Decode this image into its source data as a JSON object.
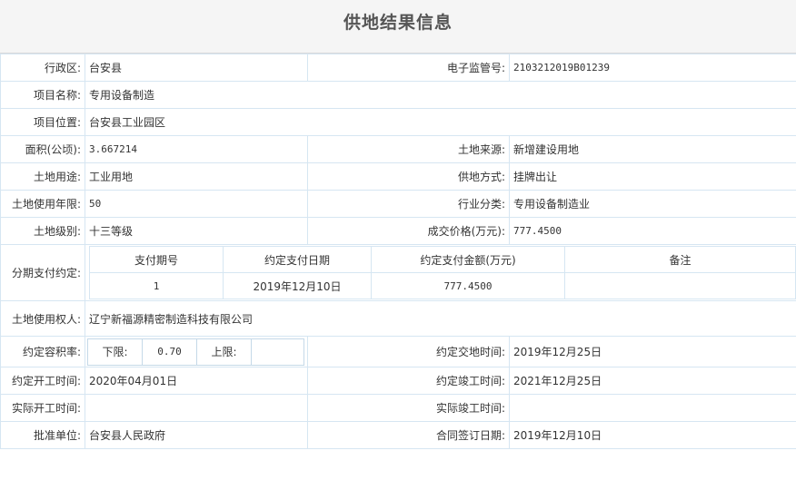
{
  "page": {
    "title": "供地结果信息"
  },
  "rows": {
    "district": {
      "label": "行政区:",
      "value": "台安县"
    },
    "supervision_no": {
      "label": "电子监管号:",
      "value": "2103212019B01239"
    },
    "project_name": {
      "label": "项目名称:",
      "value": "专用设备制造"
    },
    "project_location": {
      "label": "项目位置:",
      "value": "台安县工业园区"
    },
    "area": {
      "label": "面积(公顷):",
      "value": "3.667214"
    },
    "land_source": {
      "label": "土地来源:",
      "value": "新增建设用地"
    },
    "land_use": {
      "label": "土地用途:",
      "value": "工业用地"
    },
    "supply_method": {
      "label": "供地方式:",
      "value": "挂牌出让"
    },
    "use_years": {
      "label": "土地使用年限:",
      "value": "50"
    },
    "industry": {
      "label": "行业分类:",
      "value": "专用设备制造业"
    },
    "land_grade": {
      "label": "土地级别:",
      "value": "十三等级"
    },
    "price": {
      "label": "成交价格(万元):",
      "value": "777.4500"
    },
    "installment": {
      "label": "分期支付约定:",
      "headers": [
        "支付期号",
        "约定支付日期",
        "约定支付金额(万元)",
        "备注"
      ],
      "rows": [
        [
          "1",
          "2019年12月10日",
          "777.4500",
          ""
        ]
      ]
    },
    "land_user": {
      "label": "土地使用权人:",
      "value": "辽宁新福源精密制造科技有限公司"
    },
    "far": {
      "label": "约定容积率:",
      "lower_label": "下限:",
      "lower_value": "0.70",
      "upper_label": "上限:",
      "upper_value": ""
    },
    "handover_time": {
      "label": "约定交地时间:",
      "value": "2019年12月25日"
    },
    "start_time": {
      "label": "约定开工时间:",
      "value": "2020年04月01日"
    },
    "finish_time": {
      "label": "约定竣工时间:",
      "value": "2021年12月25日"
    },
    "actual_start": {
      "label": "实际开工时间:",
      "value": ""
    },
    "actual_finish": {
      "label": "实际竣工时间:",
      "value": ""
    },
    "approval_unit": {
      "label": "批准单位:",
      "value": "台安县人民政府"
    },
    "contract_date": {
      "label": "合同签订日期:",
      "value": "2019年12月10日"
    }
  }
}
